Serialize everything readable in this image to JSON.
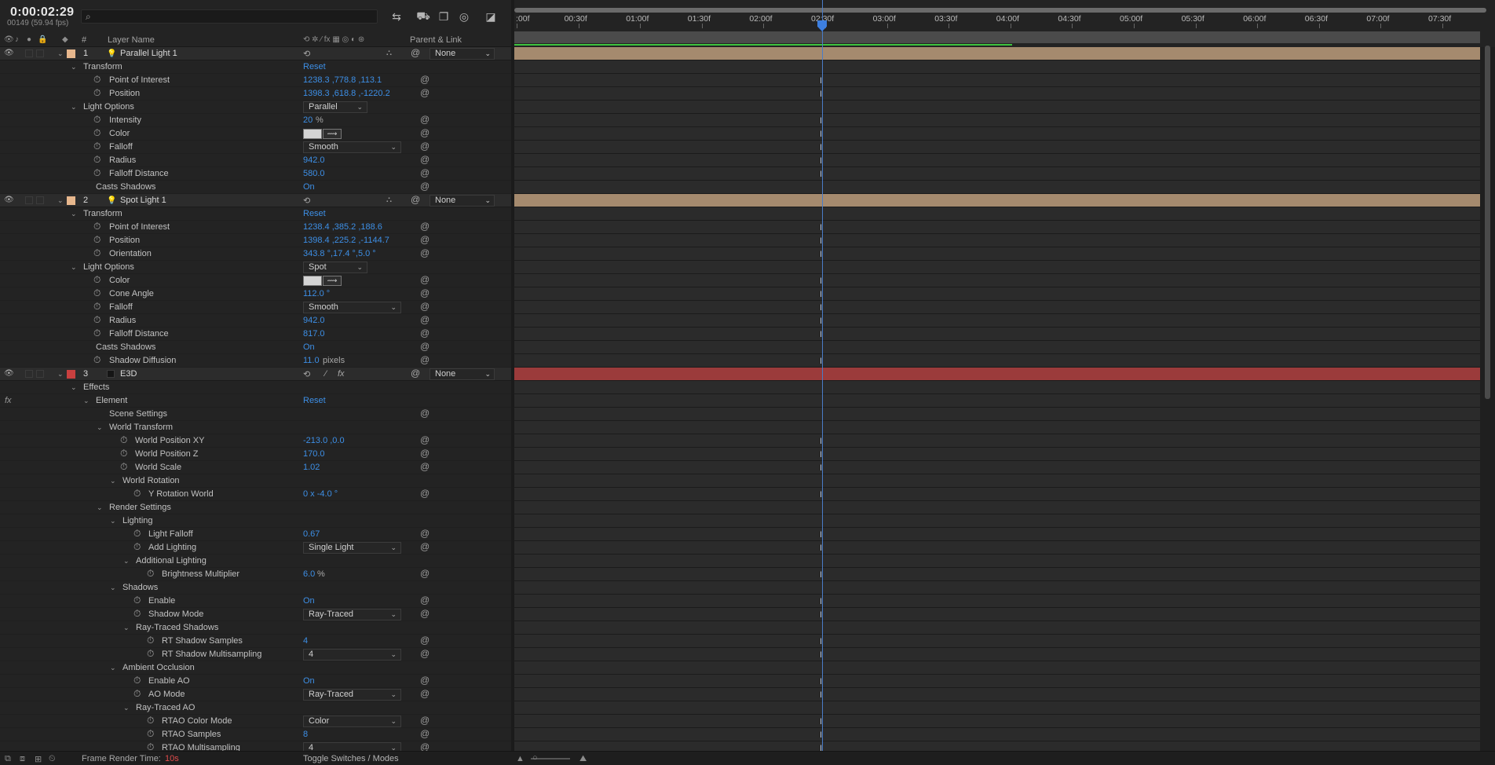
{
  "timecode": "0:00:02:29",
  "frame_info": "00149 (59.94 fps)",
  "search": {
    "placeholder": ""
  },
  "columns": {
    "label": "#",
    "layer_name": "Layer Name",
    "parent_link": "Parent & Link"
  },
  "ruler_ticks": [
    ":00f",
    "00:30f",
    "01:00f",
    "01:30f",
    "02:00f",
    "02:30f",
    "03:00f",
    "03:30f",
    "04:00f",
    "04:30f",
    "05:00f",
    "05:30f",
    "06:00f",
    "06:30f",
    "07:00f",
    "07:30f"
  ],
  "colors": {
    "accent": "#3d8fe6",
    "light_label": "#e7b78d",
    "e3d_label": "#c9403f",
    "light_bar": "#a58a6e",
    "e3d_bar": "#9b3b3b",
    "green": "#3ec23e"
  },
  "layers": [
    {
      "num": "1",
      "name": "Parallel Light 1",
      "parent": "None"
    },
    {
      "num": "2",
      "name": "Spot Light 1",
      "parent": "None"
    },
    {
      "num": "3",
      "name": "E3D",
      "parent": "None"
    }
  ],
  "props": {
    "l1_transform": "Transform",
    "l1_reset": "Reset",
    "l1_poi": "Point of Interest",
    "l1_poi_v": "1238.3 ,778.8 ,113.1",
    "l1_pos": "Position",
    "l1_pos_v": "1398.3 ,618.8 ,-1220.2",
    "l1_lightopts": "Light Options",
    "l1_type": "Parallel",
    "l1_intensity": "Intensity",
    "l1_intensity_v": "20",
    "pct": "%",
    "l1_color": "Color",
    "l1_falloff": "Falloff",
    "l1_falloff_v": "Smooth",
    "l1_radius": "Radius",
    "l1_radius_v": "942.0",
    "l1_fdist": "Falloff Distance",
    "l1_fdist_v": "580.0",
    "l1_casts": "Casts Shadows",
    "l1_casts_v": "On",
    "l2_transform": "Transform",
    "l2_reset": "Reset",
    "l2_poi": "Point of Interest",
    "l2_poi_v": "1238.4 ,385.2 ,188.6",
    "l2_pos": "Position",
    "l2_pos_v": "1398.4 ,225.2 ,-1144.7",
    "l2_orient": "Orientation",
    "l2_orient_v": "343.8 °,17.4 °,5.0 °",
    "l2_lightopts": "Light Options",
    "l2_type": "Spot",
    "l2_color": "Color",
    "l2_cone": "Cone Angle",
    "l2_cone_v": "112.0 °",
    "l2_falloff": "Falloff",
    "l2_falloff_v": "Smooth",
    "l2_radius": "Radius",
    "l2_radius_v": "942.0",
    "l2_fdist": "Falloff Distance",
    "l2_fdist_v": "817.0",
    "l2_casts": "Casts Shadows",
    "l2_casts_v": "On",
    "l2_sdiff": "Shadow Diffusion",
    "l2_sdiff_v": "11.0",
    "pixels": "pixels",
    "effects": "Effects",
    "element": "Element",
    "element_reset": "Reset",
    "scene": "Scene Settings",
    "wt": "World Transform",
    "wpxy": "World Position XY",
    "wpxy_v": "-213.0 ,0.0",
    "wpz": "World Position Z",
    "wpz_v": "170.0",
    "ws": "World Scale",
    "ws_v": "1.02",
    "wr": "World Rotation",
    "yrw": "Y Rotation World",
    "yrw_v": "0 x -4.0 °",
    "rs": "Render Settings",
    "lighting": "Lighting",
    "lf": "Light Falloff",
    "lf_v": "0.67",
    "al": "Add Lighting",
    "al_v": "Single Light",
    "addl": "Additional Lighting",
    "bm": "Brightness Multiplier",
    "bm_v": "6.0",
    "shadows": "Shadows",
    "enable": "Enable",
    "enable_v": "On",
    "smode": "Shadow Mode",
    "smode_v": "Ray-Traced",
    "rts": "Ray-Traced Shadows",
    "rtss": "RT Shadow Samples",
    "rtss_v": "4",
    "rtsm": "RT Shadow Multisampling",
    "rtsm_v": "4",
    "ao": "Ambient Occlusion",
    "eao": "Enable AO",
    "eao_v": "On",
    "aom": "AO Mode",
    "aom_v": "Ray-Traced",
    "rtao": "Ray-Traced AO",
    "rtaocm": "RTAO Color Mode",
    "rtaocm_v": "Color",
    "rtaos": "RTAO Samples",
    "rtaos_v": "8",
    "rtaom": "RTAO Multisampling",
    "rtaom_v": "4"
  },
  "bottom": {
    "frt_label": "Frame Render Time:",
    "frt_value": "10s",
    "toggle": "Toggle Switches / Modes"
  }
}
